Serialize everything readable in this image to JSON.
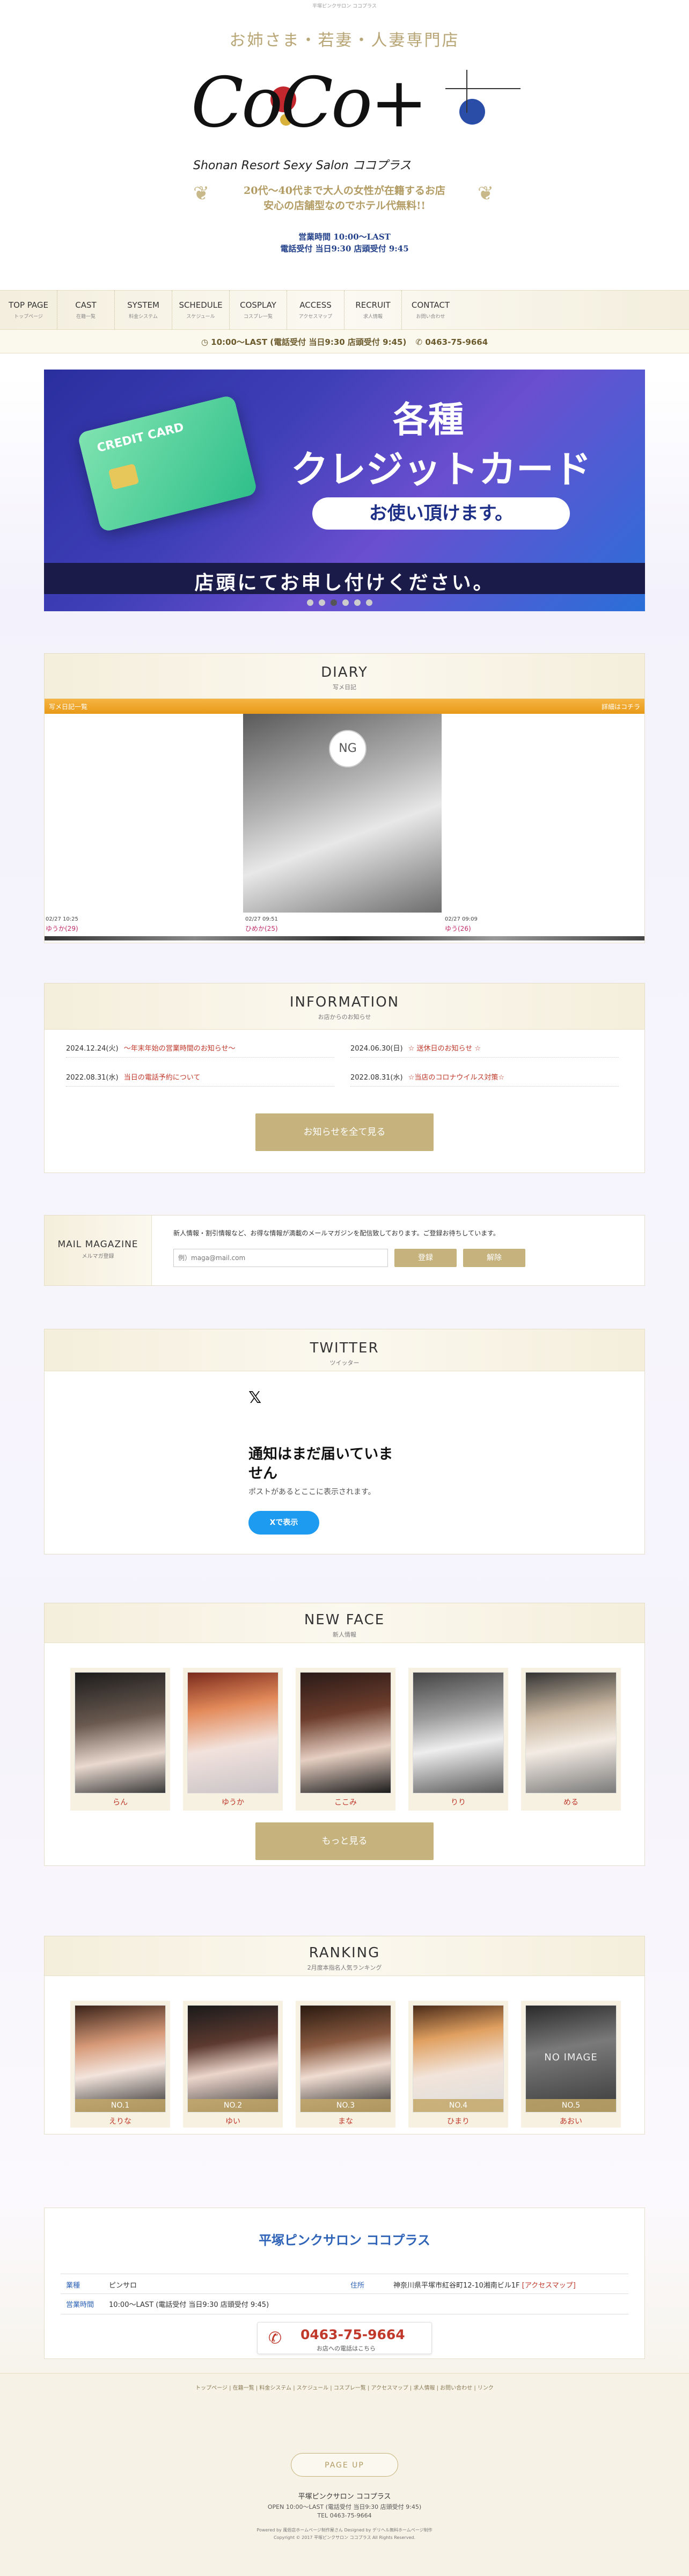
{
  "top_caption": "平塚ピンクサロン ココプラス",
  "header": {
    "tagline": "お姉さま・若妻・人妻専門店",
    "logo": "CoCo+",
    "logo_sub": "Shonan Resort Sexy Salon ココプラス",
    "desc_line1": "20代～40代まで大人の女性が在籍するお店",
    "desc_line2": "安心の店舗型なのでホテル代無料!!",
    "hours1": "営業時間 10:00～LAST",
    "hours2": "電話受付 当日9:30 店頭受付 9:45"
  },
  "nav": [
    {
      "en": "TOP PAGE",
      "ja": "トップページ"
    },
    {
      "en": "CAST",
      "ja": "在籍一覧"
    },
    {
      "en": "SYSTEM",
      "ja": "料金システム"
    },
    {
      "en": "SCHEDULE",
      "ja": "スケジュール"
    },
    {
      "en": "COSPLAY",
      "ja": "コスプレ一覧"
    },
    {
      "en": "ACCESS",
      "ja": "アクセスマップ"
    },
    {
      "en": "RECRUIT",
      "ja": "求人情報"
    },
    {
      "en": "CONTACT",
      "ja": "お問い合わせ"
    }
  ],
  "infobar": {
    "hours": "10:00～LAST (電話受付 当日9:30 店頭受付 9:45)",
    "phone": "0463-75-9664"
  },
  "banner": {
    "line1": "各種",
    "line2": "クレジットカード",
    "line3": "お使い頂けます。",
    "line4": "店頭にてお申し付けください。",
    "card_text": "CREDIT CARD"
  },
  "diary": {
    "title": "DIARY",
    "sub": "写メ日記",
    "bar_left": "写メ日記一覧",
    "bar_right": "詳細はコチラ",
    "ng": "NG",
    "items": [
      {
        "date": "02/27 10:25",
        "name": "ゆうか(29)"
      },
      {
        "date": "02/27 09:51",
        "name": "ひめか(25)"
      },
      {
        "date": "02/27 09:09",
        "name": "ゆう(26)"
      }
    ]
  },
  "information": {
    "title": "INFORMATION",
    "sub": "お店からのお知らせ",
    "items": [
      {
        "date": "2024.12.24(火)",
        "text": "～年末年始の営業時間のお知らせ～"
      },
      {
        "date": "2024.06.30(日)",
        "text": "☆ 送休日のお知らせ ☆"
      },
      {
        "date": "2022.08.31(水)",
        "text": "当日の電話予約について"
      },
      {
        "date": "2022.08.31(水)",
        "text": "☆当店のコロナウイルス対策☆"
      }
    ],
    "button": "お知らせを全て見る"
  },
  "mail": {
    "title": "MAIL MAGAZINE",
    "sub": "メルマガ登録",
    "desc": "新人情報・割引情報など、お得な情報が満載のメールマガジンを配信致しております。ご登録お待ちしています。",
    "placeholder": "例）maga@mail.com",
    "register": "登録",
    "cancel": "解除"
  },
  "twitter": {
    "title": "TWITTER",
    "sub": "ツイッター",
    "x_icon": "𝕏",
    "heading1": "通知はまだ届いていま",
    "heading2": "せん",
    "body": "ポストがあるとここに表示されます。",
    "button": "Xで表示"
  },
  "newface": {
    "title": "NEW FACE",
    "sub": "新人情報",
    "names": [
      "らん",
      "ゆうか",
      "ここみ",
      "りり",
      "める"
    ],
    "button": "もっと見る"
  },
  "ranking": {
    "title": "RANKING",
    "sub": "2月度本指名人気ランキング",
    "entries": [
      {
        "rank": "NO.1",
        "name": "えりな"
      },
      {
        "rank": "NO.2",
        "name": "ゆい"
      },
      {
        "rank": "NO.3",
        "name": "まな"
      },
      {
        "rank": "NO.4",
        "name": "ひまり"
      },
      {
        "rank": "NO.5",
        "name": "あおい"
      }
    ],
    "noimage": "NO IMAGE"
  },
  "shop": {
    "name": "平塚ピンクサロン ココプラス",
    "type_label": "業種",
    "type_value": "ピンサロ",
    "area_label": "住所",
    "area_value": "神奈川県平塚市紅谷町12-10湘南ビル1F",
    "area_link": "[アクセスマップ]",
    "hours_label": "営業時間",
    "hours_value": "10:00～LAST (電話受付 当日9:30 店頭受付 9:45)",
    "phone": "0463-75-9664",
    "phone_sub": "お店への電話はこちら"
  },
  "footer": {
    "links": "トップページ | 在籍一覧 | 料金システム | スケジュール | コスプレ一覧 | アクセスマップ | 求人情報 | お問い合わせ | リンク",
    "pageup": "PAGE UP",
    "name": "平塚ピンクサロン ココプラス",
    "open": "OPEN 10:00～LAST (電話受付 当日9:30 店頭受付 9:45)",
    "tel": "TEL 0463-75-9664",
    "powered": "Powered by 風俗店ホームページ制作屋さん Designed by デリヘル無料ホームページ制作",
    "copyright": "Copyright © 2017 平塚ピンクサロン ココプラス All Rights Reserved."
  },
  "colors": {
    "gold": "#c6b27d",
    "accent_red": "#c0392b",
    "blue": "#2e63b8",
    "banner_blue": "#1d2f86"
  }
}
